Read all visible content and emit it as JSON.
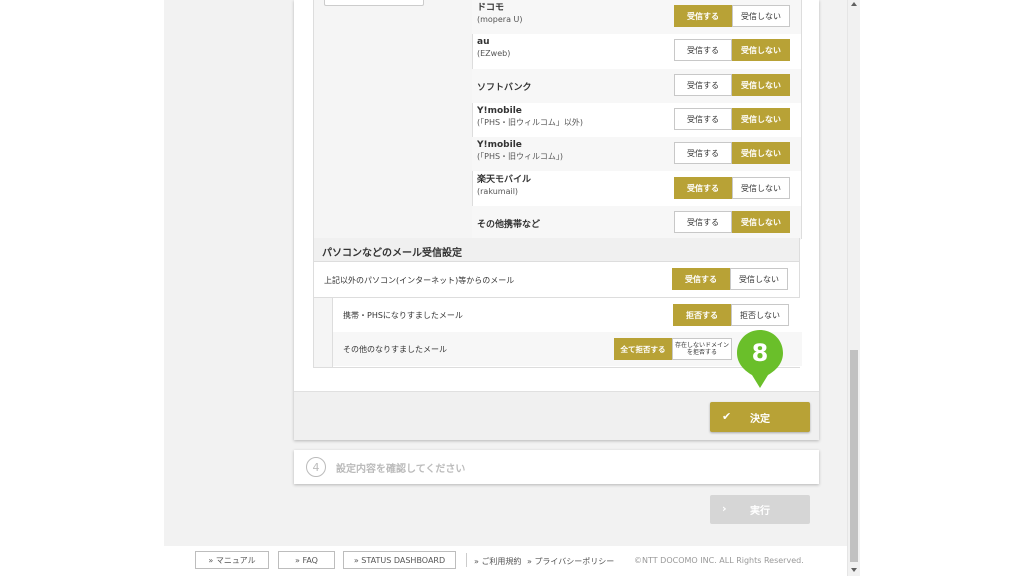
{
  "carriers": [
    {
      "name": "ドコモ",
      "sub": "(mopera U)",
      "selected": "receive"
    },
    {
      "name": "au",
      "sub": "(EZweb)",
      "selected": "reject"
    },
    {
      "name": "ソフトバンク",
      "sub": "",
      "selected": "reject"
    },
    {
      "name": "Y!mobile",
      "sub": "(「PHS・旧ウィルコム」以外)",
      "selected": "reject"
    },
    {
      "name": "Y!mobile",
      "sub": "(「PHS・旧ウィルコム」)",
      "selected": "reject"
    },
    {
      "name": "楽天モバイル",
      "sub": "(rakumail)",
      "selected": "receive"
    },
    {
      "name": "その他携帯など",
      "sub": "",
      "selected": "reject"
    }
  ],
  "toggle_labels": {
    "receive": "受信する",
    "reject": "受信しない"
  },
  "pc_section": {
    "title": "パソコンなどのメール受信設定",
    "pc_row": {
      "label": "上記以外のパソコン(インターネット)等からのメール",
      "on": "受信する",
      "off": "受信しない"
    },
    "spoof_row": {
      "label": "携帯・PHSになりすましたメール",
      "on": "拒否する",
      "off": "拒否しない"
    },
    "other_spoof_row": {
      "label": "その他のなりすましたメール",
      "on": "全て拒否する",
      "off_line1": "存在しないドメイン",
      "off_line2": "を拒否する"
    }
  },
  "decide_button": {
    "label": "決定"
  },
  "step_badge": "8",
  "step4": {
    "number": "4",
    "label": "設定内容を確認してください"
  },
  "execute_button": {
    "label": "実行"
  },
  "footer": {
    "manual": "» マニュアル",
    "faq": "» FAQ",
    "status": "» STATUS DASHBOARD",
    "terms": "» ご利用規約",
    "privacy": "» プライバシーポリシー",
    "copyright": "©NTT DOCOMO INC. ALL Rights Reserved."
  },
  "colors": {
    "accent": "#b8a236",
    "badge": "#6abf2a",
    "disabled": "#d6d6d6"
  }
}
